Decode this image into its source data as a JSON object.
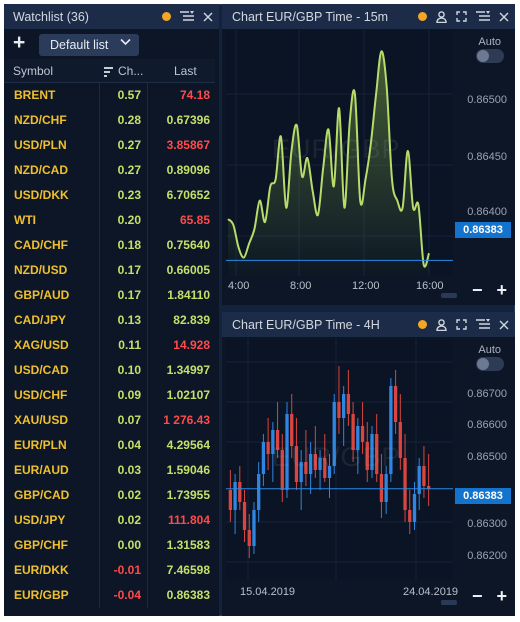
{
  "watchlist": {
    "title": "Watchlist (36)",
    "add_label": "+",
    "list_name": "Default list",
    "columns": {
      "symbol": "Symbol",
      "change": "Ch...",
      "last": "Last"
    },
    "rows": [
      {
        "symbol": "BRENT",
        "change": "0.57",
        "last": "74.18",
        "last_dir": "down"
      },
      {
        "symbol": "NZD/CHF",
        "change": "0.28",
        "last": "0.67396",
        "last_dir": "up"
      },
      {
        "symbol": "USD/PLN",
        "change": "0.27",
        "last": "3.85867",
        "last_dir": "down"
      },
      {
        "symbol": "NZD/CAD",
        "change": "0.27",
        "last": "0.89096",
        "last_dir": "up"
      },
      {
        "symbol": "USD/DKK",
        "change": "0.23",
        "last": "6.70652",
        "last_dir": "up"
      },
      {
        "symbol": "WTI",
        "change": "0.20",
        "last": "65.85",
        "last_dir": "down"
      },
      {
        "symbol": "CAD/CHF",
        "change": "0.18",
        "last": "0.75640",
        "last_dir": "up"
      },
      {
        "symbol": "NZD/USD",
        "change": "0.17",
        "last": "0.66005",
        "last_dir": "up"
      },
      {
        "symbol": "GBP/AUD",
        "change": "0.17",
        "last": "1.84110",
        "last_dir": "up"
      },
      {
        "symbol": "CAD/JPY",
        "change": "0.13",
        "last": "82.839",
        "last_dir": "up"
      },
      {
        "symbol": "XAG/USD",
        "change": "0.11",
        "last": "14.928",
        "last_dir": "down"
      },
      {
        "symbol": "USD/CAD",
        "change": "0.10",
        "last": "1.34997",
        "last_dir": "up"
      },
      {
        "symbol": "USD/CHF",
        "change": "0.09",
        "last": "1.02107",
        "last_dir": "up"
      },
      {
        "symbol": "XAU/USD",
        "change": "0.07",
        "last": "1 276.43",
        "last_dir": "down"
      },
      {
        "symbol": "EUR/PLN",
        "change": "0.04",
        "last": "4.29564",
        "last_dir": "up"
      },
      {
        "symbol": "EUR/AUD",
        "change": "0.03",
        "last": "1.59046",
        "last_dir": "up"
      },
      {
        "symbol": "GBP/CAD",
        "change": "0.02",
        "last": "1.73955",
        "last_dir": "up"
      },
      {
        "symbol": "USD/JPY",
        "change": "0.02",
        "last": "111.804",
        "last_dir": "down"
      },
      {
        "symbol": "GBP/CHF",
        "change": "0.00",
        "last": "1.31583",
        "last_dir": "up"
      },
      {
        "symbol": "EUR/DKK",
        "change": "-0.01",
        "last": "7.46598",
        "last_dir": "up"
      },
      {
        "symbol": "EUR/GBP",
        "change": "-0.04",
        "last": "0.86383",
        "last_dir": "up"
      }
    ]
  },
  "chart1": {
    "title": "Chart EUR/GBP Time - 15m",
    "watermark": "EUR/GBP",
    "auto_label": "Auto",
    "price_tag": "0.86383",
    "y_ticks": [
      "0.86500",
      "0.86450",
      "0.86400"
    ],
    "x_ticks": [
      "4:00",
      "8:00",
      "12:00",
      "16:00"
    ],
    "zoom_out": "−",
    "zoom_in": "+"
  },
  "chart2": {
    "title": "Chart EUR/GBP Time - 4H",
    "watermark": "EUR/GBP",
    "auto_label": "Auto",
    "price_tag": "0.86383",
    "y_ticks": [
      "0.86700",
      "0.86600",
      "0.86500",
      "0.86300",
      "0.86200"
    ],
    "x_ticks": [
      "15.04.2019",
      "24.04.2019"
    ],
    "zoom_out": "−",
    "zoom_in": "+"
  },
  "chart_data": [
    {
      "type": "area",
      "title": "Chart EUR/GBP Time - 15m",
      "x_ticks": [
        "4:00",
        "8:00",
        "12:00",
        "16:00"
      ],
      "ylim": [
        0.86372,
        0.86545
      ],
      "last_price": 0.86383,
      "series": [
        {
          "values": [
            0.86412,
            0.86408,
            0.86392,
            0.86385,
            0.86395,
            0.86405,
            0.86425,
            0.8641,
            0.86435,
            0.8644,
            0.8647,
            0.8642,
            0.8646,
            0.86478,
            0.86442,
            0.86455,
            0.86432,
            0.86415,
            0.86448,
            0.86475,
            0.86435,
            0.8649,
            0.8642,
            0.8648,
            0.865,
            0.86425,
            0.8644,
            0.86465,
            0.865,
            0.8653,
            0.86505,
            0.8644,
            0.86425,
            0.8642,
            0.8646,
            0.8642,
            0.86422,
            0.8638,
            0.86388
          ]
        }
      ]
    },
    {
      "type": "candlestick",
      "title": "Chart EUR/GBP Time - 4H",
      "x_ticks": [
        "15.04.2019",
        "24.04.2019"
      ],
      "ylim": [
        0.86155,
        0.8676
      ],
      "last_price": 0.86383,
      "candles": [
        [
          0.8638,
          0.8643,
          0.863,
          0.8633
        ],
        [
          0.8633,
          0.8642,
          0.8627,
          0.864
        ],
        [
          0.864,
          0.8644,
          0.8633,
          0.8635
        ],
        [
          0.8635,
          0.8638,
          0.8625,
          0.8628
        ],
        [
          0.8628,
          0.8632,
          0.8621,
          0.8624
        ],
        [
          0.8624,
          0.8635,
          0.8622,
          0.8633
        ],
        [
          0.8633,
          0.8645,
          0.863,
          0.8642
        ],
        [
          0.8642,
          0.8652,
          0.8639,
          0.865
        ],
        [
          0.865,
          0.8656,
          0.8643,
          0.8647
        ],
        [
          0.8647,
          0.8655,
          0.864,
          0.8653
        ],
        [
          0.8653,
          0.866,
          0.8646,
          0.8648
        ],
        [
          0.8648,
          0.8652,
          0.8635,
          0.8638
        ],
        [
          0.8638,
          0.866,
          0.8636,
          0.8657
        ],
        [
          0.8657,
          0.8662,
          0.8646,
          0.8649
        ],
        [
          0.8649,
          0.8656,
          0.8638,
          0.864
        ],
        [
          0.864,
          0.8648,
          0.8633,
          0.8645
        ],
        [
          0.8645,
          0.8653,
          0.8639,
          0.8642
        ],
        [
          0.8642,
          0.865,
          0.8637,
          0.8647
        ],
        [
          0.8647,
          0.8654,
          0.8641,
          0.8643
        ],
        [
          0.8643,
          0.8648,
          0.8638,
          0.8646
        ],
        [
          0.8646,
          0.8652,
          0.864,
          0.8641
        ],
        [
          0.8641,
          0.8647,
          0.8636,
          0.8644
        ],
        [
          0.8644,
          0.8662,
          0.8642,
          0.866
        ],
        [
          0.866,
          0.8669,
          0.8652,
          0.8656
        ],
        [
          0.8656,
          0.8664,
          0.8649,
          0.8662
        ],
        [
          0.8662,
          0.8668,
          0.8654,
          0.8657
        ],
        [
          0.8657,
          0.866,
          0.8645,
          0.8648
        ],
        [
          0.8648,
          0.8656,
          0.8642,
          0.8654
        ],
        [
          0.8654,
          0.866,
          0.8647,
          0.865
        ],
        [
          0.865,
          0.8655,
          0.864,
          0.8643
        ],
        [
          0.8643,
          0.8654,
          0.8641,
          0.8652
        ],
        [
          0.8652,
          0.8657,
          0.864,
          0.8642
        ],
        [
          0.8642,
          0.8647,
          0.8631,
          0.8635
        ],
        [
          0.8635,
          0.8644,
          0.8632,
          0.8642
        ],
        [
          0.8642,
          0.8666,
          0.864,
          0.8664
        ],
        [
          0.8664,
          0.8668,
          0.8652,
          0.8655
        ],
        [
          0.8655,
          0.8662,
          0.8643,
          0.8646
        ],
        [
          0.8646,
          0.8652,
          0.863,
          0.8633
        ],
        [
          0.8633,
          0.8638,
          0.8627,
          0.863
        ],
        [
          0.863,
          0.864,
          0.8628,
          0.8637
        ],
        [
          0.8637,
          0.8646,
          0.8633,
          0.8644
        ],
        [
          0.8644,
          0.8649,
          0.8636,
          0.8639
        ],
        [
          0.8639,
          0.8647,
          0.8634,
          0.86383
        ]
      ]
    }
  ]
}
